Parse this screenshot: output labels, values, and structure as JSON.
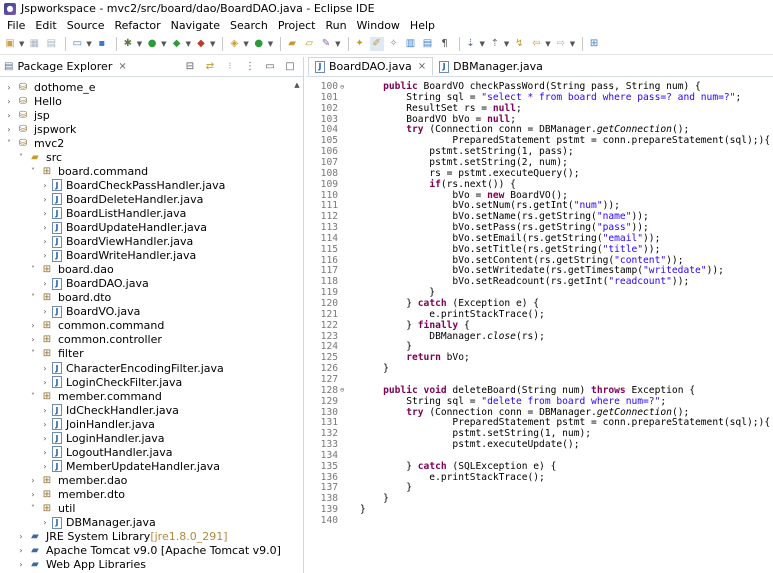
{
  "window": {
    "title": "Jspworkspace - mvc2/src/board/dao/BoardDAO.java - Eclipse IDE"
  },
  "menubar": [
    "File",
    "Edit",
    "Source",
    "Refactor",
    "Navigate",
    "Search",
    "Project",
    "Run",
    "Window",
    "Help"
  ],
  "package_explorer": {
    "tab_label": "Package Explorer",
    "close_glyph": "⨯",
    "tree": [
      {
        "depth": 0,
        "twisty": "›",
        "icon": "project",
        "label": "dothome_e"
      },
      {
        "depth": 0,
        "twisty": "›",
        "icon": "project",
        "label": "Hello"
      },
      {
        "depth": 0,
        "twisty": "›",
        "icon": "project",
        "label": "jsp"
      },
      {
        "depth": 0,
        "twisty": "›",
        "icon": "project",
        "label": "jspwork"
      },
      {
        "depth": 0,
        "twisty": "˅",
        "icon": "project",
        "label": "mvc2"
      },
      {
        "depth": 1,
        "twisty": "˅",
        "icon": "srcfolder",
        "label": "src"
      },
      {
        "depth": 2,
        "twisty": "˅",
        "icon": "package",
        "label": "board.command"
      },
      {
        "depth": 3,
        "twisty": "›",
        "icon": "java",
        "label": "BoardCheckPassHandler.java"
      },
      {
        "depth": 3,
        "twisty": "›",
        "icon": "java",
        "label": "BoardDeleteHandler.java"
      },
      {
        "depth": 3,
        "twisty": "›",
        "icon": "java",
        "label": "BoardListHandler.java"
      },
      {
        "depth": 3,
        "twisty": "›",
        "icon": "java",
        "label": "BoardUpdateHandler.java"
      },
      {
        "depth": 3,
        "twisty": "›",
        "icon": "java",
        "label": "BoardViewHandler.java"
      },
      {
        "depth": 3,
        "twisty": "›",
        "icon": "java",
        "label": "BoardWriteHandler.java"
      },
      {
        "depth": 2,
        "twisty": "˅",
        "icon": "package",
        "label": "board.dao"
      },
      {
        "depth": 3,
        "twisty": "›",
        "icon": "java",
        "label": "BoardDAO.java"
      },
      {
        "depth": 2,
        "twisty": "˅",
        "icon": "package",
        "label": "board.dto"
      },
      {
        "depth": 3,
        "twisty": "›",
        "icon": "java",
        "label": "BoardVO.java"
      },
      {
        "depth": 2,
        "twisty": "›",
        "icon": "package",
        "label": "common.command"
      },
      {
        "depth": 2,
        "twisty": "›",
        "icon": "package",
        "label": "common.controller"
      },
      {
        "depth": 2,
        "twisty": "˅",
        "icon": "package",
        "label": "filter"
      },
      {
        "depth": 3,
        "twisty": "›",
        "icon": "java",
        "label": "CharacterEncodingFilter.java"
      },
      {
        "depth": 3,
        "twisty": "›",
        "icon": "java",
        "label": "LoginCheckFilter.java"
      },
      {
        "depth": 2,
        "twisty": "˅",
        "icon": "package",
        "label": "member.command"
      },
      {
        "depth": 3,
        "twisty": "›",
        "icon": "java",
        "label": "IdCheckHandler.java"
      },
      {
        "depth": 3,
        "twisty": "›",
        "icon": "java",
        "label": "JoinHandler.java"
      },
      {
        "depth": 3,
        "twisty": "›",
        "icon": "java",
        "label": "LoginHandler.java"
      },
      {
        "depth": 3,
        "twisty": "›",
        "icon": "java",
        "label": "LogoutHandler.java"
      },
      {
        "depth": 3,
        "twisty": "›",
        "icon": "java",
        "label": "MemberUpdateHandler.java"
      },
      {
        "depth": 2,
        "twisty": "›",
        "icon": "package",
        "label": "member.dao"
      },
      {
        "depth": 2,
        "twisty": "›",
        "icon": "package",
        "label": "member.dto"
      },
      {
        "depth": 2,
        "twisty": "˅",
        "icon": "package",
        "label": "util"
      },
      {
        "depth": 3,
        "twisty": "›",
        "icon": "java",
        "label": "DBManager.java"
      },
      {
        "depth": 1,
        "twisty": "›",
        "icon": "lib",
        "label": "JRE System Library",
        "suffix": " [jre1.8.0_291]"
      },
      {
        "depth": 1,
        "twisty": "›",
        "icon": "lib",
        "label": "Apache Tomcat v9.0 [Apache Tomcat v9.0]"
      },
      {
        "depth": 1,
        "twisty": "›",
        "icon": "lib",
        "label": "Web App Libraries"
      }
    ]
  },
  "editor": {
    "tabs": [
      {
        "label": "BoardDAO.java",
        "active": true,
        "close_glyph": "⨯"
      },
      {
        "label": "DBManager.java",
        "active": false
      }
    ],
    "lines": [
      {
        "n": "100",
        "fold": "⊖",
        "segs": [
          [
            "    ",
            ""
          ],
          [
            "public ",
            "kw"
          ],
          [
            "BoardVO checkPassWord(String pass, String num) {",
            ""
          ]
        ]
      },
      {
        "n": "101",
        "segs": [
          [
            "        String sql = ",
            ""
          ],
          [
            "\"select * from board where pass=? and num=?\"",
            "str"
          ],
          [
            ";",
            ""
          ]
        ]
      },
      {
        "n": "102",
        "segs": [
          [
            "        ResultSet rs = ",
            ""
          ],
          [
            "null",
            "kw"
          ],
          [
            ";",
            ""
          ]
        ]
      },
      {
        "n": "103",
        "segs": [
          [
            "        BoardVO bVo = ",
            ""
          ],
          [
            "null",
            "kw"
          ],
          [
            ";",
            ""
          ]
        ]
      },
      {
        "n": "104",
        "segs": [
          [
            "        ",
            ""
          ],
          [
            "try ",
            "kw"
          ],
          [
            "(Connection conn = DBManager.",
            ""
          ],
          [
            "getConnection",
            "it"
          ],
          [
            "();",
            ""
          ]
        ]
      },
      {
        "n": "105",
        "segs": [
          [
            "                PreparedStatement pstmt = conn.prepareStatement(sql);){",
            ""
          ]
        ]
      },
      {
        "n": "106",
        "segs": [
          [
            "            pstmt.setString(1, pass);",
            ""
          ]
        ]
      },
      {
        "n": "107",
        "segs": [
          [
            "            pstmt.setString(2, num);",
            ""
          ]
        ]
      },
      {
        "n": "108",
        "segs": [
          [
            "            rs = pstmt.executeQuery();",
            ""
          ]
        ]
      },
      {
        "n": "109",
        "segs": [
          [
            "            ",
            ""
          ],
          [
            "if",
            "kw"
          ],
          [
            "(rs.next()) {",
            ""
          ]
        ]
      },
      {
        "n": "110",
        "segs": [
          [
            "                bVo = ",
            ""
          ],
          [
            "new ",
            "kw"
          ],
          [
            "BoardVO();",
            ""
          ]
        ]
      },
      {
        "n": "111",
        "segs": [
          [
            "                bVo.setNum(rs.getInt(",
            ""
          ],
          [
            "\"num\"",
            "str"
          ],
          [
            "));",
            ""
          ]
        ]
      },
      {
        "n": "112",
        "segs": [
          [
            "                bVo.setName(rs.getString(",
            ""
          ],
          [
            "\"name\"",
            "str"
          ],
          [
            "));",
            ""
          ]
        ]
      },
      {
        "n": "113",
        "segs": [
          [
            "                bVo.setPass(rs.getString(",
            ""
          ],
          [
            "\"pass\"",
            "str"
          ],
          [
            "));",
            ""
          ]
        ]
      },
      {
        "n": "114",
        "segs": [
          [
            "                bVo.setEmail(rs.getString(",
            ""
          ],
          [
            "\"email\"",
            "str"
          ],
          [
            "));",
            ""
          ]
        ]
      },
      {
        "n": "115",
        "segs": [
          [
            "                bVo.setTitle(rs.getString(",
            ""
          ],
          [
            "\"title\"",
            "str"
          ],
          [
            "));",
            ""
          ]
        ]
      },
      {
        "n": "116",
        "segs": [
          [
            "                bVo.setContent(rs.getString(",
            ""
          ],
          [
            "\"content\"",
            "str"
          ],
          [
            "));",
            ""
          ]
        ]
      },
      {
        "n": "117",
        "segs": [
          [
            "                bVo.setWritedate(rs.getTimestamp(",
            ""
          ],
          [
            "\"writedate\"",
            "str"
          ],
          [
            "));",
            ""
          ]
        ]
      },
      {
        "n": "118",
        "segs": [
          [
            "                bVo.setReadcount(rs.getInt(",
            ""
          ],
          [
            "\"readcount\"",
            "str"
          ],
          [
            "));",
            ""
          ]
        ]
      },
      {
        "n": "119",
        "segs": [
          [
            "            }",
            ""
          ]
        ]
      },
      {
        "n": "120",
        "segs": [
          [
            "        } ",
            ""
          ],
          [
            "catch ",
            "kw"
          ],
          [
            "(Exception e) {",
            ""
          ]
        ]
      },
      {
        "n": "121",
        "segs": [
          [
            "            e.printStackTrace();",
            ""
          ]
        ]
      },
      {
        "n": "122",
        "segs": [
          [
            "        } ",
            ""
          ],
          [
            "finally ",
            "kw"
          ],
          [
            "{",
            ""
          ]
        ]
      },
      {
        "n": "123",
        "segs": [
          [
            "            DBManager.",
            ""
          ],
          [
            "close",
            "it"
          ],
          [
            "(rs);",
            ""
          ]
        ]
      },
      {
        "n": "124",
        "segs": [
          [
            "        }",
            ""
          ]
        ]
      },
      {
        "n": "125",
        "segs": [
          [
            "        ",
            ""
          ],
          [
            "return ",
            "kw"
          ],
          [
            "bVo;",
            ""
          ]
        ]
      },
      {
        "n": "126",
        "segs": [
          [
            "    }",
            ""
          ]
        ]
      },
      {
        "n": "127",
        "segs": [
          [
            "",
            ""
          ]
        ]
      },
      {
        "n": "128",
        "fold": "⊖",
        "segs": [
          [
            "    ",
            ""
          ],
          [
            "public void ",
            "kw"
          ],
          [
            "deleteBoard(String num) ",
            ""
          ],
          [
            "throws ",
            "kw"
          ],
          [
            "Exception {",
            ""
          ]
        ]
      },
      {
        "n": "129",
        "segs": [
          [
            "        String sql = ",
            ""
          ],
          [
            "\"delete from board where num=?\"",
            "str"
          ],
          [
            ";",
            ""
          ]
        ]
      },
      {
        "n": "130",
        "segs": [
          [
            "        ",
            ""
          ],
          [
            "try ",
            "kw"
          ],
          [
            "(Connection conn = DBManager.",
            ""
          ],
          [
            "getConnection",
            "it"
          ],
          [
            "();",
            ""
          ]
        ]
      },
      {
        "n": "131",
        "segs": [
          [
            "                PreparedStatement pstmt = conn.prepareStatement(sql);){",
            ""
          ]
        ]
      },
      {
        "n": "132",
        "segs": [
          [
            "                pstmt.setString(1, num);",
            ""
          ]
        ]
      },
      {
        "n": "133",
        "segs": [
          [
            "                pstmt.executeUpdate();",
            ""
          ]
        ]
      },
      {
        "n": "134",
        "segs": [
          [
            "",
            ""
          ]
        ]
      },
      {
        "n": "135",
        "segs": [
          [
            "        } ",
            ""
          ],
          [
            "catch ",
            "kw"
          ],
          [
            "(SQLException e) {",
            ""
          ]
        ]
      },
      {
        "n": "136",
        "segs": [
          [
            "            e.printStackTrace();",
            ""
          ]
        ]
      },
      {
        "n": "137",
        "segs": [
          [
            "        }",
            ""
          ]
        ]
      },
      {
        "n": "138",
        "segs": [
          [
            "    }",
            ""
          ]
        ]
      },
      {
        "n": "139",
        "segs": [
          [
            "}",
            ""
          ]
        ]
      },
      {
        "n": "140",
        "segs": [
          [
            "",
            ""
          ]
        ]
      }
    ]
  },
  "colors": {
    "keyword": "#7f0055",
    "string": "#2a00ff",
    "line_number": "#787878"
  }
}
